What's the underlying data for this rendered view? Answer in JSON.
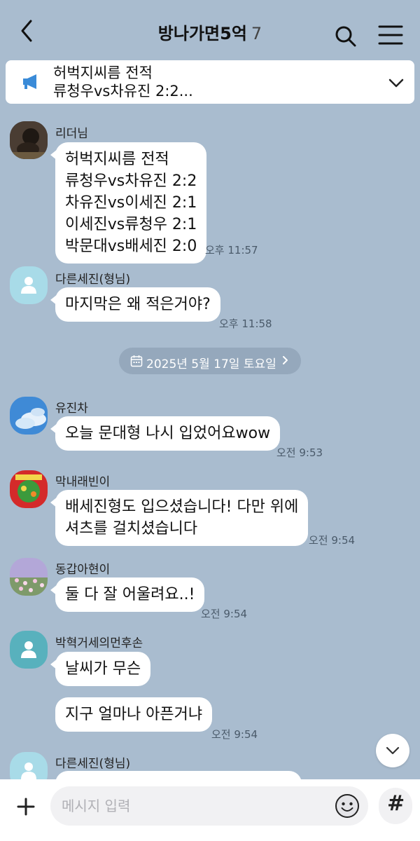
{
  "header": {
    "title": "방나가면5억",
    "member_count": "7",
    "back_icon": "chevron-left-icon",
    "search_icon": "search-icon",
    "menu_icon": "hamburger-menu-icon"
  },
  "notice": {
    "icon": "megaphone-icon",
    "line1": "허벅지씨름 전적",
    "line2": "류청우vs차유진 2:2...",
    "expand_icon": "chevron-down-icon"
  },
  "messages": [
    {
      "sender": "리더님",
      "lines": [
        "허벅지씨름 전적",
        "류청우vs차유진 2:2",
        "차유진vs이세진 2:1",
        "이세진vs류청우 2:1",
        "박문대vs배세진 2:0"
      ],
      "time": "오후 11:57"
    },
    {
      "sender": "다른세진(형님)",
      "lines": [
        "마지막은 왜 적은거야?"
      ],
      "time": "오후 11:58"
    },
    {
      "sender": "유진차",
      "lines": [
        "오늘 문대형 나시 입었어요wow"
      ],
      "time": "오전 9:53"
    },
    {
      "sender": "막내래빈이",
      "lines": [
        "배세진형도 입으셨습니다! 다만 위에",
        "셔츠를 걸치셨습니다"
      ],
      "time": "오전 9:54"
    },
    {
      "sender": "동갑아현이",
      "lines": [
        "둘 다 잘 어울려요..!"
      ],
      "time": "오전 9:54"
    },
    {
      "sender": "박혁거세의먼후손",
      "lines": [
        "날씨가 무슨",
        "지구 얼마나 아픈거냐"
      ],
      "time": "오전 9:54"
    },
    {
      "sender": "다른세진(형님)"
    }
  ],
  "date_divider": "2025년 5월 17일 토요일",
  "input": {
    "placeholder": "메시지 입력",
    "plus_icon": "plus-icon",
    "emoji_icon": "emoji-icon",
    "hash_label": "#"
  },
  "colors": {
    "background": "#a9bccf",
    "bubble": "#ffffff",
    "notice_accent": "#3a8bd8",
    "default_avatar": "#a8dbe8"
  }
}
